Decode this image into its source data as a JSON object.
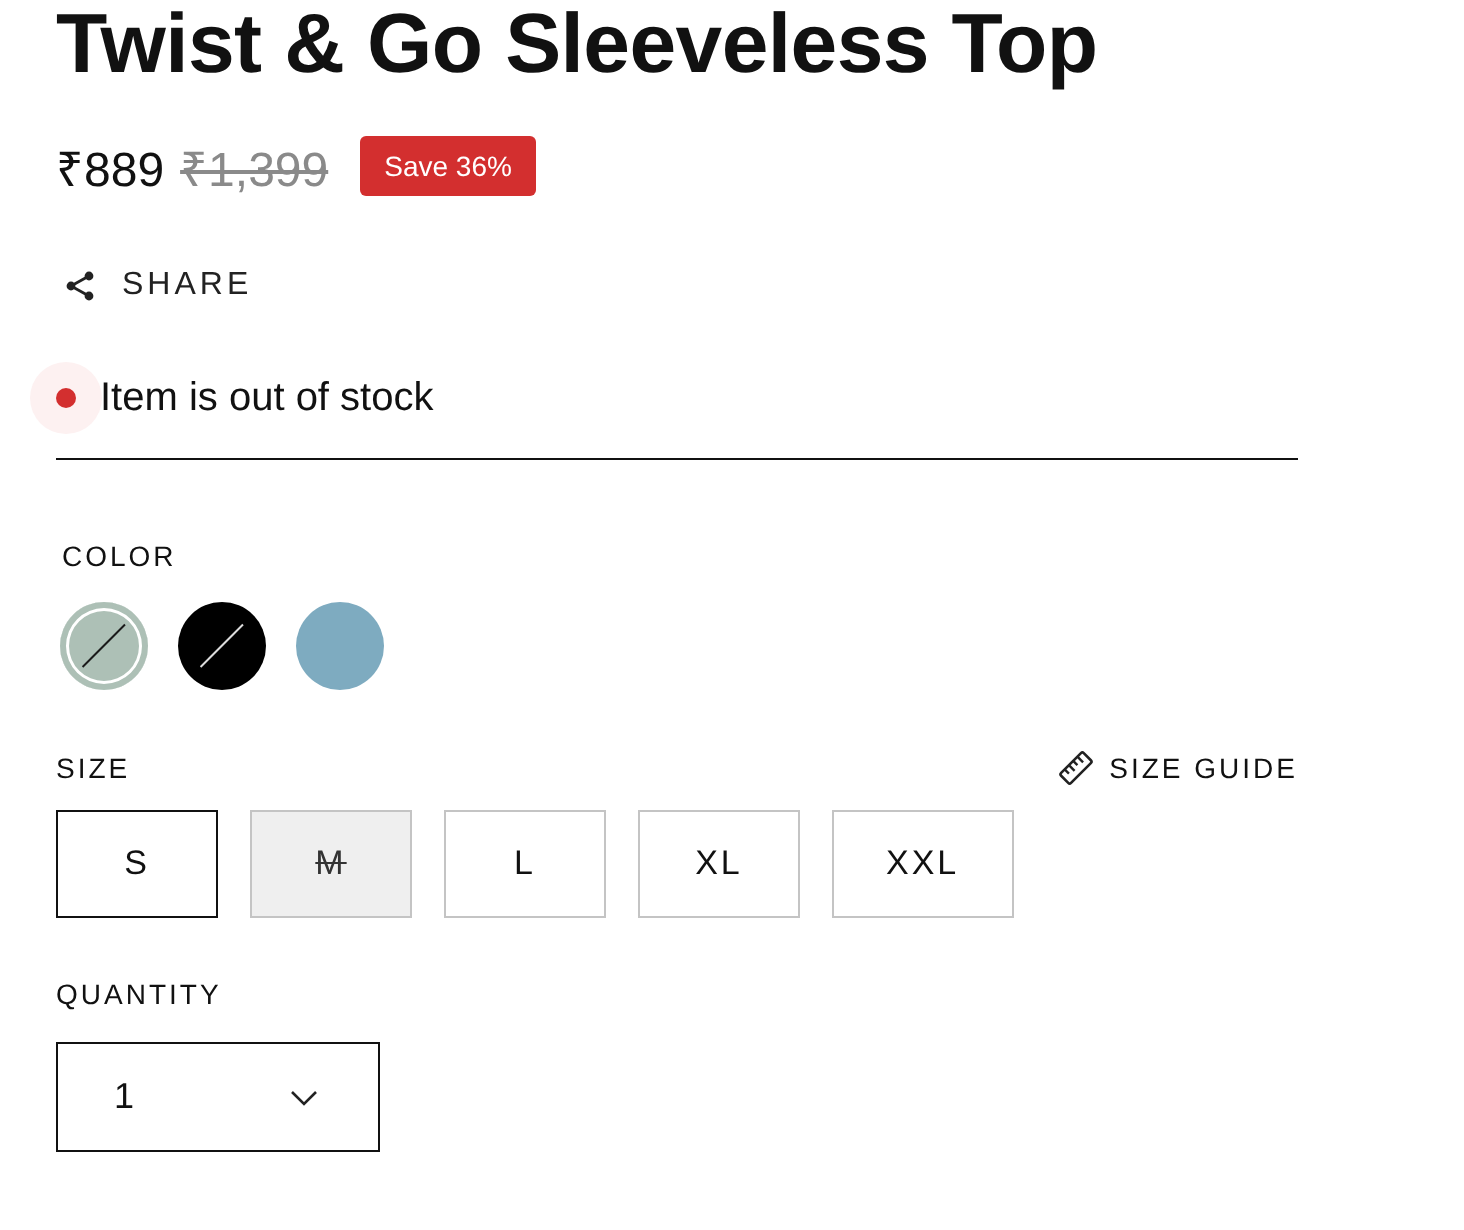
{
  "product": {
    "title": "Twist & Go Sleeveless Top",
    "price": "₹889",
    "compare_price": "₹1,399",
    "badge": "Save 36%"
  },
  "share": {
    "label": "SHARE"
  },
  "stock": {
    "text": "Item is out of stock",
    "in_stock": false
  },
  "color": {
    "label": "COLOR",
    "swatches": [
      {
        "color": "#adc0b6",
        "selected": true,
        "unavailable": true
      },
      {
        "color": "#000000",
        "selected": false,
        "unavailable": true
      },
      {
        "color": "#7eabc0",
        "selected": false,
        "unavailable": false
      }
    ]
  },
  "size": {
    "label": "SIZE",
    "guide": "SIZE GUIDE",
    "options": [
      {
        "label": "S",
        "selected": true,
        "disabled": false
      },
      {
        "label": "M",
        "selected": false,
        "disabled": true
      },
      {
        "label": "L",
        "selected": false,
        "disabled": false
      },
      {
        "label": "XL",
        "selected": false,
        "disabled": false
      },
      {
        "label": "XXL",
        "selected": false,
        "disabled": false
      }
    ]
  },
  "quantity": {
    "label": "QUANTITY",
    "value": "1"
  }
}
